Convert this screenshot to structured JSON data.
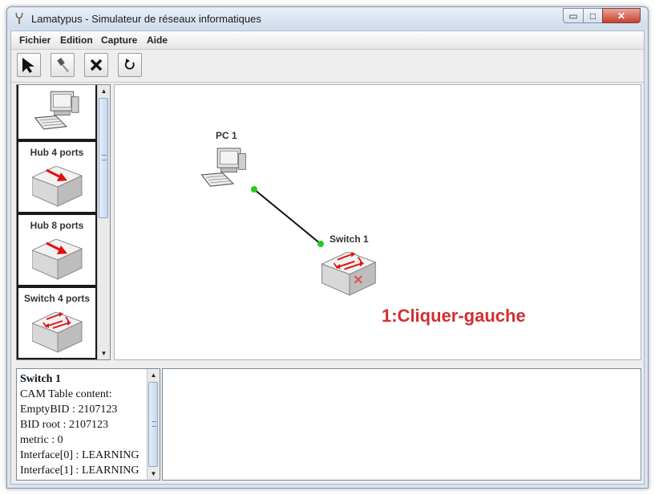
{
  "window": {
    "title": "Lamatypus - Simulateur de réseaux informatiques",
    "minimize_glyph": "▭",
    "maximize_glyph": "□",
    "close_glyph": "✕"
  },
  "menu": [
    "Fichier",
    "Edition",
    "Capture",
    "Aide"
  ],
  "toolbar": [
    {
      "name": "select-tool",
      "icon": "arrow-pointer-icon"
    },
    {
      "name": "cable-tool",
      "icon": "cable-plug-icon"
    },
    {
      "name": "delete-tool",
      "icon": "x-delete-icon"
    },
    {
      "name": "reset-tool",
      "icon": "rotate-icon"
    }
  ],
  "palette": {
    "items": [
      {
        "label": "",
        "icon": "computer-icon"
      },
      {
        "label": "Hub 4 ports",
        "icon": "hub-icon"
      },
      {
        "label": "Hub 8 ports",
        "icon": "hub-icon"
      },
      {
        "label": "Switch 4 ports",
        "icon": "switch-icon"
      }
    ]
  },
  "canvas": {
    "devices": [
      {
        "name": "PC 1",
        "type": "pc"
      },
      {
        "name": "Switch 1",
        "type": "switch"
      }
    ],
    "annotation": "1:Cliquer-gauche"
  },
  "info_panel": {
    "title": "Switch 1",
    "lines": [
      "CAM Table content:",
      "EmptyBID : 2107123",
      "BID root : 2107123",
      "metric : 0",
      "Interface[0] : LEARNING",
      "Interface[1] : LEARNING"
    ]
  },
  "console": {
    "text": ""
  },
  "colors": {
    "annotation": "#d32f2f",
    "link_endpoint": "#22cc22",
    "hub_arrow": "#e01010",
    "device_box": "#d9d9d9"
  }
}
